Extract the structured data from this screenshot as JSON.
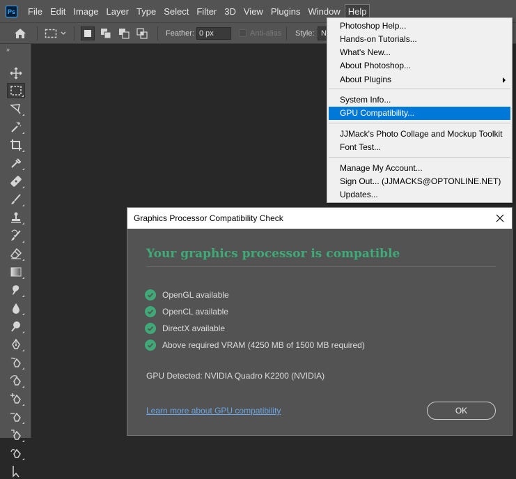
{
  "app": {
    "logo_text": "Ps",
    "accent": "#31a8ff"
  },
  "menubar": {
    "items": [
      {
        "label": "File"
      },
      {
        "label": "Edit"
      },
      {
        "label": "Image"
      },
      {
        "label": "Layer"
      },
      {
        "label": "Type"
      },
      {
        "label": "Select"
      },
      {
        "label": "Filter"
      },
      {
        "label": "3D"
      },
      {
        "label": "View"
      },
      {
        "label": "Plugins"
      },
      {
        "label": "Window"
      },
      {
        "label": "Help"
      }
    ],
    "active": "Help"
  },
  "options_bar": {
    "feather_label": "Feather:",
    "feather_value": "0 px",
    "antialias_label": "Anti-alias",
    "style_label": "Style:",
    "style_value": "N"
  },
  "toolbar": {
    "collapse_glyph": "»",
    "tools": [
      "move-icon",
      "marquee-icon",
      "lasso-icon",
      "magic-wand-icon",
      "crop-icon",
      "eyedropper-icon",
      "healing-brush-icon",
      "brush-icon",
      "clone-stamp-icon",
      "history-brush-icon",
      "eraser-icon",
      "gradient-icon",
      "smudge-icon",
      "dodge-icon",
      "zoom-icon",
      "pen-icon",
      "freeform-pen-icon",
      "curvature-pen-icon",
      "add-anchor-icon",
      "delete-anchor-icon",
      "convert-point-icon",
      "path-select-icon"
    ],
    "selected": "marquee-icon"
  },
  "help_menu": {
    "items": [
      {
        "label": "Photoshop Help..."
      },
      {
        "label": "Hands-on Tutorials..."
      },
      {
        "label": "What's New..."
      },
      {
        "label": "About Photoshop..."
      },
      {
        "label": "About Plugins"
      },
      {
        "label": "System Info..."
      },
      {
        "label": "GPU Compatibility..."
      },
      {
        "label": "JJMack's Photo Collage and Mockup Toolkit"
      },
      {
        "label": "Font Test..."
      },
      {
        "label": "Manage My Account..."
      },
      {
        "label": "Sign Out... (JJMACKS@OPTONLINE.NET)"
      },
      {
        "label": "Updates..."
      }
    ],
    "highlighted": "GPU Compatibility...",
    "highlight_color": "#0078d7"
  },
  "dialog": {
    "title": "Graphics Processor Compatibility Check",
    "heading": "Your graphics processor is compatible",
    "heading_color": "#3faa78",
    "checks": [
      {
        "label": "OpenGL available"
      },
      {
        "label": "OpenCL available"
      },
      {
        "label": "DirectX available"
      },
      {
        "label": "Above required VRAM (4250 MB of 1500 MB required)"
      }
    ],
    "gpu_detected": "GPU Detected: NVIDIA Quadro K2200 (NVIDIA)",
    "learn_more_link": "Learn more about GPU compatibility",
    "ok_label": "OK"
  }
}
